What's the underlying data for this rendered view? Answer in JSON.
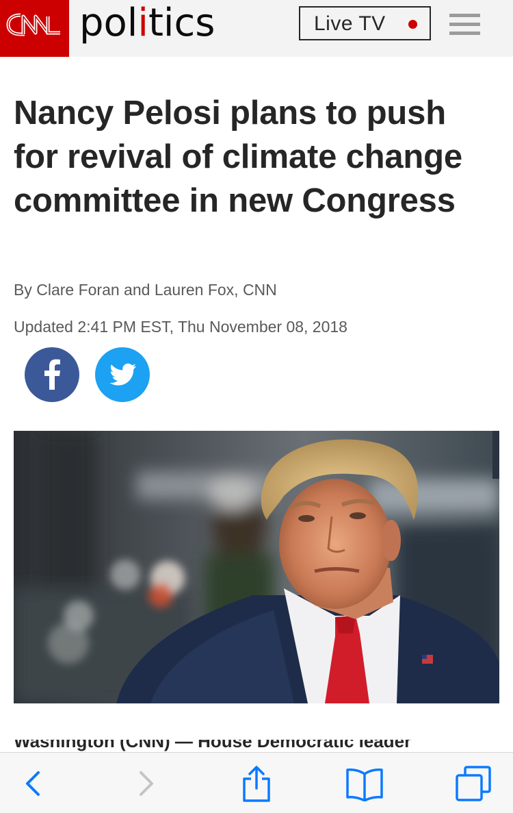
{
  "header": {
    "brand": "CNN",
    "section_prefix": "pol",
    "section_accent": "i",
    "section_suffix": "tics",
    "live_tv_label": "Live TV",
    "menu_icon": "hamburger-menu-icon"
  },
  "article": {
    "headline": "Nancy Pelosi plans to push for revival of climate change committee in new Congress",
    "byline": "By Clare Foran and Lauren Fox, CNN",
    "updated": "Updated 2:41 PM EST, Thu November 08, 2018",
    "body_start": "Washington (CNN) — House Democratic leader"
  },
  "share": {
    "facebook_icon": "facebook-icon",
    "twitter_icon": "twitter-icon"
  },
  "toolbar": {
    "back_icon": "back-chevron-icon",
    "forward_icon": "forward-chevron-icon",
    "share_icon": "share-icon",
    "bookmarks_icon": "bookmarks-icon",
    "tabs_icon": "tabs-icon"
  },
  "colors": {
    "cnn_red": "#cc0000",
    "header_bg": "#f3f3f3",
    "facebook": "#3b5998",
    "twitter": "#1da1f2",
    "ios_blue": "#0a7aff"
  }
}
